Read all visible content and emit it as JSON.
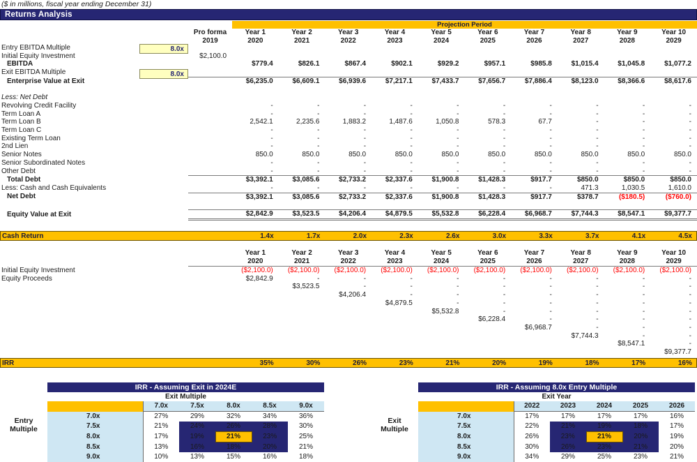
{
  "note": "($ in millions, fiscal year ending December 31)",
  "section": {
    "title": "Returns Analysis"
  },
  "projection": {
    "band_label": "Projection Period"
  },
  "columns": {
    "proforma": {
      "line1": "Pro forma",
      "line2": "2019"
    },
    "years": [
      {
        "line1": "Year 1",
        "line2": "2020"
      },
      {
        "line1": "Year 2",
        "line2": "2021"
      },
      {
        "line1": "Year 3",
        "line2": "2022"
      },
      {
        "line1": "Year 4",
        "line2": "2023"
      },
      {
        "line1": "Year 5",
        "line2": "2024"
      },
      {
        "line1": "Year 6",
        "line2": "2025"
      },
      {
        "line1": "Year 7",
        "line2": "2026"
      },
      {
        "line1": "Year 8",
        "line2": "2027"
      },
      {
        "line1": "Year 9",
        "line2": "2028"
      },
      {
        "line1": "Year 10",
        "line2": "2029"
      }
    ]
  },
  "inputs": {
    "entry_multiple_label": "Entry EBITDA Multiple",
    "entry_multiple_value": "8.0x",
    "exit_multiple_label": "Exit EBITDA Multiple",
    "exit_multiple_value": "8.0x"
  },
  "rows": {
    "initial_equity": {
      "label": "Initial Equity Investment",
      "proforma": "$2,100.0",
      "values": [
        "",
        "",
        "",
        "",
        "",
        "",
        "",
        "",
        "",
        ""
      ]
    },
    "ebitda": {
      "label": "EBITDA",
      "values": [
        "$779.4",
        "$826.1",
        "$867.4",
        "$902.1",
        "$929.2",
        "$957.1",
        "$985.8",
        "$1,015.4",
        "$1,045.8",
        "$1,077.2"
      ]
    },
    "ev_at_exit": {
      "label": "Enterprise Value at Exit",
      "values": [
        "$6,235.0",
        "$6,609.1",
        "$6,939.6",
        "$7,217.1",
        "$7,433.7",
        "$7,656.7",
        "$7,886.4",
        "$8,123.0",
        "$8,366.6",
        "$8,617.6"
      ]
    },
    "less_net_debt_header": {
      "label": "Less: Net Debt"
    },
    "revolver": {
      "label": "Revolving Credit Facility",
      "values": [
        "-",
        "-",
        "-",
        "-",
        "-",
        "-",
        "-",
        "-",
        "-",
        "-"
      ]
    },
    "tla": {
      "label": "Term Loan A",
      "values": [
        "-",
        "-",
        "-",
        "-",
        "-",
        "-",
        "-",
        "-",
        "-",
        "-"
      ]
    },
    "tlb": {
      "label": "Term Loan B",
      "values": [
        "2,542.1",
        "2,235.6",
        "1,883.2",
        "1,487.6",
        "1,050.8",
        "578.3",
        "67.7",
        "-",
        "-",
        "-"
      ]
    },
    "tlc": {
      "label": "Term Loan C",
      "values": [
        "-",
        "-",
        "-",
        "-",
        "-",
        "-",
        "-",
        "-",
        "-",
        "-"
      ]
    },
    "existing_tl": {
      "label": "Existing Term Loan",
      "values": [
        "-",
        "-",
        "-",
        "-",
        "-",
        "-",
        "-",
        "-",
        "-",
        "-"
      ]
    },
    "second_lien": {
      "label": "2nd Lien",
      "values": [
        "-",
        "-",
        "-",
        "-",
        "-",
        "-",
        "-",
        "-",
        "-",
        "-"
      ]
    },
    "senior_notes": {
      "label": "Senior Notes",
      "values": [
        "850.0",
        "850.0",
        "850.0",
        "850.0",
        "850.0",
        "850.0",
        "850.0",
        "850.0",
        "850.0",
        "850.0"
      ]
    },
    "senior_sub_notes": {
      "label": "Senior Subordinated Notes",
      "values": [
        "-",
        "-",
        "-",
        "-",
        "-",
        "-",
        "-",
        "-",
        "-",
        "-"
      ]
    },
    "other_debt": {
      "label": "Other Debt",
      "values": [
        "-",
        "-",
        "-",
        "-",
        "-",
        "-",
        "-",
        "-",
        "-",
        "-"
      ]
    },
    "total_debt": {
      "label": "Total Debt",
      "values": [
        "$3,392.1",
        "$3,085.6",
        "$2,733.2",
        "$2,337.6",
        "$1,900.8",
        "$1,428.3",
        "$917.7",
        "$850.0",
        "$850.0",
        "$850.0"
      ]
    },
    "less_cash": {
      "label": "Less: Cash and Cash Equivalents",
      "values": [
        "-",
        "-",
        "-",
        "-",
        "-",
        "-",
        "-",
        "471.3",
        "1,030.5",
        "1,610.0"
      ]
    },
    "net_debt": {
      "label": "Net Debt",
      "values": [
        "$3,392.1",
        "$3,085.6",
        "$2,733.2",
        "$2,337.6",
        "$1,900.8",
        "$1,428.3",
        "$917.7",
        "$378.7",
        "($180.5)",
        "($760.0)"
      ],
      "negatives": [
        false,
        false,
        false,
        false,
        false,
        false,
        false,
        false,
        true,
        true
      ]
    },
    "equity_value_at_exit": {
      "label": "Equity Value at Exit",
      "values": [
        "$2,842.9",
        "$3,523.5",
        "$4,206.4",
        "$4,879.5",
        "$5,532.8",
        "$6,228.4",
        "$6,968.7",
        "$7,744.3",
        "$8,547.1",
        "$9,377.7"
      ]
    }
  },
  "cash_return": {
    "label": "Cash Return",
    "values": [
      "1.4x",
      "1.7x",
      "2.0x",
      "2.3x",
      "2.6x",
      "3.0x",
      "3.3x",
      "3.7x",
      "4.1x",
      "4.5x"
    ]
  },
  "irr_section": {
    "initial_equity": {
      "label": "Initial Equity Investment",
      "values": [
        "($2,100.0)",
        "($2,100.0)",
        "($2,100.0)",
        "($2,100.0)",
        "($2,100.0)",
        "($2,100.0)",
        "($2,100.0)",
        "($2,100.0)",
        "($2,100.0)",
        "($2,100.0)"
      ]
    },
    "equity_proceeds": {
      "label": "Equity Proceeds",
      "matrix": [
        [
          "$2,842.9",
          "-",
          "-",
          "-",
          "-",
          "-",
          "-",
          "-",
          "-",
          "-"
        ],
        [
          "",
          "$3,523.5",
          "-",
          "-",
          "-",
          "-",
          "-",
          "-",
          "-",
          "-"
        ],
        [
          "",
          "",
          "$4,206.4",
          "-",
          "-",
          "-",
          "-",
          "-",
          "-",
          "-"
        ],
        [
          "",
          "",
          "",
          "$4,879.5",
          "-",
          "-",
          "-",
          "-",
          "-",
          "-"
        ],
        [
          "",
          "",
          "",
          "",
          "$5,532.8",
          "-",
          "-",
          "-",
          "-",
          "-"
        ],
        [
          "",
          "",
          "",
          "",
          "",
          "$6,228.4",
          "-",
          "-",
          "-",
          "-"
        ],
        [
          "",
          "",
          "",
          "",
          "",
          "",
          "$6,968.7",
          "-",
          "-",
          "-"
        ],
        [
          "",
          "",
          "",
          "",
          "",
          "",
          "",
          "$7,744.3",
          "-",
          "-"
        ],
        [
          "",
          "",
          "",
          "",
          "",
          "",
          "",
          "",
          "$8,547.1",
          "-"
        ],
        [
          "",
          "",
          "",
          "",
          "",
          "",
          "",
          "",
          "",
          "$9,377.7"
        ]
      ]
    }
  },
  "irr_row": {
    "label": "IRR",
    "values": [
      "35%",
      "30%",
      "26%",
      "23%",
      "21%",
      "20%",
      "19%",
      "18%",
      "17%",
      "16%"
    ]
  },
  "sensitivity_left": {
    "title": "IRR - Assuming Exit in 2024E",
    "col_axis_label": "Exit Multiple",
    "row_axis_label_line1": "Entry",
    "row_axis_label_line2": "Multiple",
    "col_headers": [
      "7.0x",
      "7.5x",
      "8.0x",
      "8.5x",
      "9.0x"
    ],
    "selected_col_index": 2,
    "row_headers": [
      "7.0x",
      "7.5x",
      "8.0x",
      "8.5x",
      "9.0x"
    ],
    "selected_row_index": 2,
    "values": [
      [
        "27%",
        "29%",
        "32%",
        "34%",
        "36%"
      ],
      [
        "21%",
        "24%",
        "26%",
        "28%",
        "30%"
      ],
      [
        "17%",
        "19%",
        "21%",
        "23%",
        "25%"
      ],
      [
        "13%",
        "16%",
        "18%",
        "20%",
        "21%"
      ],
      [
        "10%",
        "13%",
        "15%",
        "16%",
        "18%"
      ]
    ],
    "highlight_rows": [
      1,
      2,
      3
    ],
    "highlight_cols": [
      1,
      2,
      3
    ]
  },
  "sensitivity_right": {
    "title": "IRR - Assuming 8.0x Entry Multiple",
    "col_axis_label": "Exit Year",
    "row_axis_label_line1": "Exit",
    "row_axis_label_line2": "Multiple",
    "col_headers": [
      "2022",
      "2023",
      "2024",
      "2025",
      "2026"
    ],
    "selected_col_index": 2,
    "row_headers": [
      "7.0x",
      "7.5x",
      "8.0x",
      "8.5x",
      "9.0x"
    ],
    "selected_row_index": 2,
    "values": [
      [
        "17%",
        "17%",
        "17%",
        "17%",
        "16%"
      ],
      [
        "22%",
        "21%",
        "19%",
        "18%",
        "17%"
      ],
      [
        "26%",
        "23%",
        "21%",
        "20%",
        "19%"
      ],
      [
        "30%",
        "26%",
        "23%",
        "21%",
        "20%"
      ],
      [
        "34%",
        "29%",
        "25%",
        "23%",
        "21%"
      ]
    ],
    "highlight_rows": [
      1,
      2,
      3
    ],
    "highlight_cols": [
      1,
      2,
      3
    ]
  },
  "colors": {
    "navy": "#262673",
    "gold": "#FFC000",
    "input_yellow": "#FFFFBF",
    "light_blue": "#CFE7F3",
    "negative_red": "#FF0000",
    "selected_blue": "#1f4fd8"
  }
}
